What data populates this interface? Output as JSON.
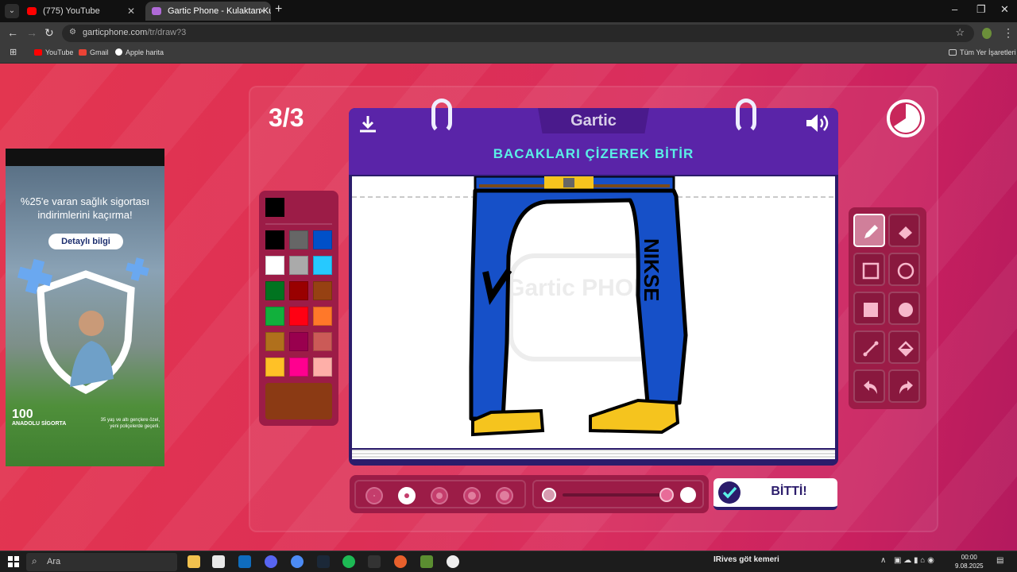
{
  "browser": {
    "tabs": [
      {
        "title": "(775) YouTube"
      },
      {
        "title": "Gartic Phone - Kulaktan Kulağa"
      }
    ],
    "url_host": "garticphone.com",
    "url_path": "/tr/draw?3",
    "bookmarks": [
      {
        "label": "YouTube"
      },
      {
        "label": "Gmail"
      },
      {
        "label": "Apple harita"
      }
    ],
    "all_bookmarks_label": "Tüm Yer İşaretleri"
  },
  "ad": {
    "headline": "%25'e varan sağlık sigortası indirimlerini kaçırma!",
    "button": "Detaylı bilgi",
    "brand": "ANADOLU SİGORTA",
    "badge": "100",
    "footnote": "35 yaş ve altı gençlere özel, yeni poliçelerde geçerli."
  },
  "game": {
    "round": "3/3",
    "logo": "Gartic",
    "prompt": "BACAKLARI ÇİZEREK BİTİR",
    "drawing_text": "NIKSE",
    "watermark": "Gartic PHONE",
    "done_label": "BİTTİ!",
    "palette": [
      "#000000",
      "#666666",
      "#0050c8",
      "#ffffff",
      "#aaaaaa",
      "#26c9ff",
      "#017420",
      "#990000",
      "#964112",
      "#11b03c",
      "#ff0013",
      "#ff7829",
      "#b0701c",
      "#99004e",
      "#cb5a57",
      "#ffc126",
      "#ff008f",
      "#feafa8"
    ],
    "current_color": "#000000",
    "selected_swatch": "#8b3a14",
    "brush_size_selected": 2,
    "opacity_level": 1.0
  },
  "taskbar": {
    "search_placeholder": "Ara",
    "media_artist": "IRives",
    "media_title": "göt kemeri",
    "time": "00:00",
    "date": "9.08.2025"
  }
}
